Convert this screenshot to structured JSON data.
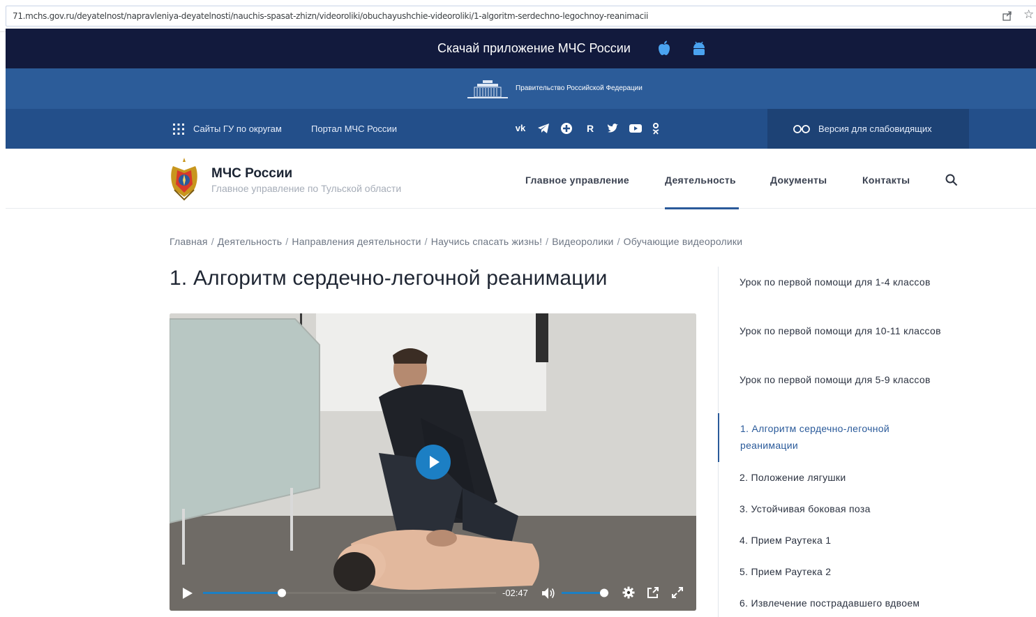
{
  "browser": {
    "url": "71.mchs.gov.ru/deyatelnost/napravleniya-deyatelnosti/nauchis-spasat-zhizn/videoroliki/obuchayushchie-videoroliki/1-algoritm-serdechno-legochnoy-reanimacii"
  },
  "app_banner": {
    "text": "Скачай приложение МЧС России"
  },
  "gov_bar": {
    "text": "Правительство Российской Федерации"
  },
  "top_nav": {
    "regions_label": "Сайты ГУ по округам",
    "portal_label": "Портал МЧС России",
    "social": [
      "вк",
      "telegram",
      "ok-circle",
      "R",
      "twitter",
      "youtube",
      "odnoklassniki"
    ],
    "vision_label": "Версия для слабовидящих"
  },
  "header": {
    "brand": "МЧС России",
    "subtitle": "Главное управление по Тульской области",
    "nav": [
      "Главное управление",
      "Деятельность",
      "Документы",
      "Контакты"
    ],
    "active_nav": "Деятельность"
  },
  "breadcrumb": [
    "Главная",
    "Деятельность",
    "Направления деятельности",
    "Научись спасать жизнь!",
    "Видеоролики",
    "Обучающие видеоролики"
  ],
  "page": {
    "title": "1. Алгоритм сердечно-легочной реанимации"
  },
  "video": {
    "time_remaining": "-02:47",
    "progress": 0.27,
    "volume": 0.9
  },
  "sidebar": {
    "items": [
      "Урок по первой помощи для 1-4 классов",
      "Урок по первой помощи для 10-11 классов",
      "Урок по первой помощи для 5-9 классов",
      "1. Алгоритм сердечно-легочной реанимации",
      "2. Положение лягушки",
      "3. Устойчивая боковая поза",
      "4. Прием Раутека 1",
      "5. Прием Раутека 2",
      "6. Извлечение пострадавшего вдвоем"
    ],
    "active_index": 3
  },
  "colors": {
    "app_banner_bg": "#121a3d",
    "gov_bar_bg": "#2c5c99",
    "top_nav_bg": "#234f8a",
    "accent": "#2a5a9a",
    "play_button": "#1c7fc4"
  }
}
